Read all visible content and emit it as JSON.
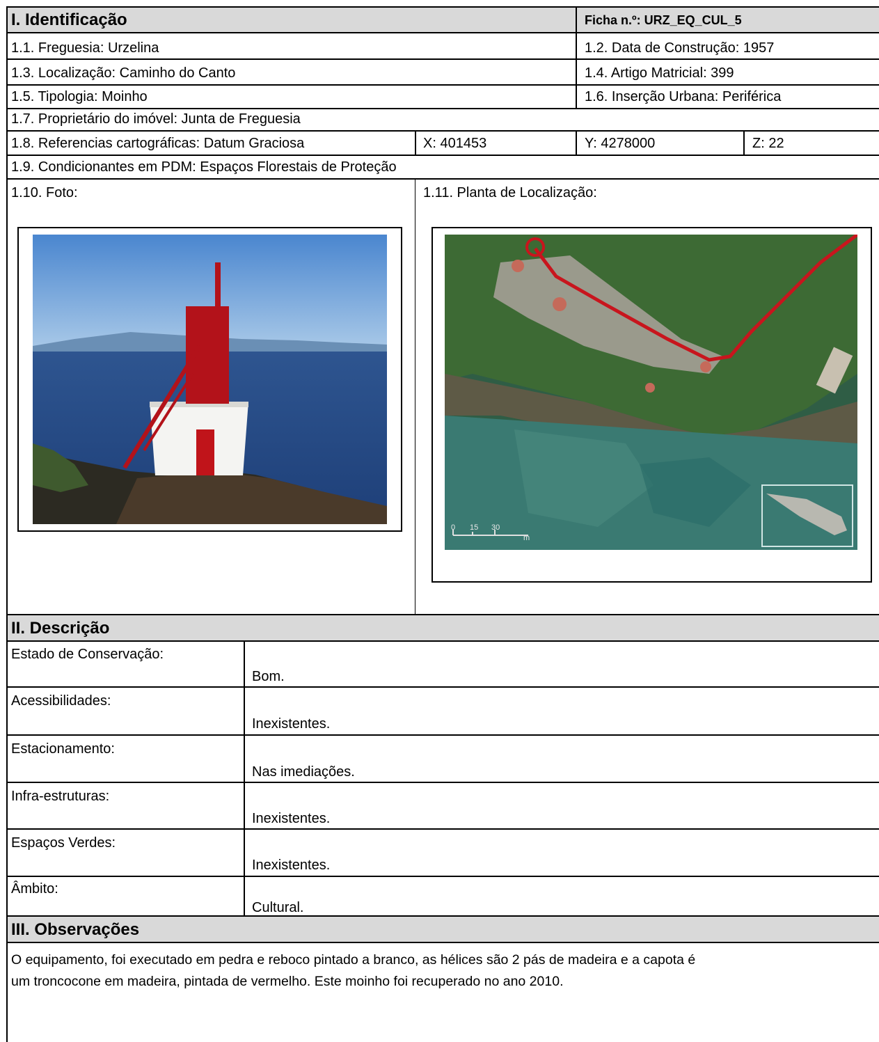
{
  "section1": {
    "title": "I. Identificação",
    "ficha": "Ficha n.º: URZ_EQ_CUL_5",
    "freguesia": "1.1. Freguesia: Urzelina",
    "data_construcao": "1.2. Data de Construção: 1957",
    "localizacao": "1.3. Localização: Caminho do Canto",
    "artigo_matricial": "1.4. Artigo Matricial: 399",
    "tipologia": "1.5. Tipologia: Moinho",
    "insercao_urbana": "1.6. Inserção Urbana: Periférica",
    "proprietario": "1.7. Proprietário do imóvel: Junta de Freguesia",
    "referencias": "1.8. Referencias cartográficas: Datum Graciosa",
    "x": "X: 401453",
    "y": "Y: 4278000",
    "z": "Z: 22",
    "condicionantes": "1.9. Condicionantes em PDM: Espaços Florestais de Proteção",
    "foto_label": "1.10. Foto:",
    "planta_label": "1.11. Planta de Localização:",
    "scale_labels": [
      "0",
      "15",
      "30"
    ],
    "scale_unit": "m"
  },
  "section2": {
    "title": "II. Descrição",
    "rows": [
      {
        "label": "Estado de Conservação:",
        "value": "Bom."
      },
      {
        "label": "Acessibilidades:",
        "value": "Inexistentes."
      },
      {
        "label": "Estacionamento:",
        "value": "Nas imediações."
      },
      {
        "label": "Infra-estruturas:",
        "value": "Inexistentes."
      },
      {
        "label": "Espaços Verdes:",
        "value": "Inexistentes."
      },
      {
        "label": "Âmbito:",
        "value": "Cultural."
      }
    ]
  },
  "section3": {
    "title": "III. Observações",
    "text_line1": "O equipamento, foi executado em pedra e reboco pintado a branco, as hélices são 2 pás de madeira e a capota é",
    "text_line2": "um troncocone em madeira, pintada de vermelho. Este moinho foi recuperado no ano 2010."
  }
}
